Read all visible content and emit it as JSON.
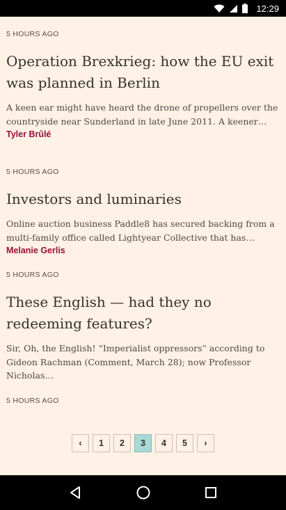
{
  "status": {
    "time": "12:29"
  },
  "articles": [
    {
      "timestamp": "5 HOURS AGO",
      "headline": "Operation Brexkrieg: how the EU exit was planned in Berlin",
      "summary": "A keen ear might have heard the drone of propellers over the countryside near Sunderland in late June 2011. A keener…",
      "author": "Tyler Brûlé"
    },
    {
      "timestamp": "5 HOURS AGO",
      "headline": "Investors and luminaries",
      "summary": "Online auction business Paddle8 has secured backing from a multi-family office called Lightyear Collective that has…",
      "author": "Melanie Gerlis"
    },
    {
      "timestamp": "5 HOURS AGO",
      "headline": "These English — had they no redeeming features?",
      "summary": "Sir, Oh, the English! “Imperialist oppressors” according to Gideon Rachman (Comment, March 28); now Professor Nicholas…",
      "author": ""
    },
    {
      "timestamp": "5 HOURS AGO"
    }
  ],
  "pagination": {
    "prev": "‹",
    "pages": [
      "1",
      "2",
      "3",
      "4",
      "5"
    ],
    "current": "3",
    "next": "›"
  },
  "icons": {
    "wifi": "wifi-icon",
    "signal": "signal-icon",
    "battery": "battery-icon",
    "back": "back-icon",
    "home": "home-icon",
    "recents": "recents-icon"
  }
}
